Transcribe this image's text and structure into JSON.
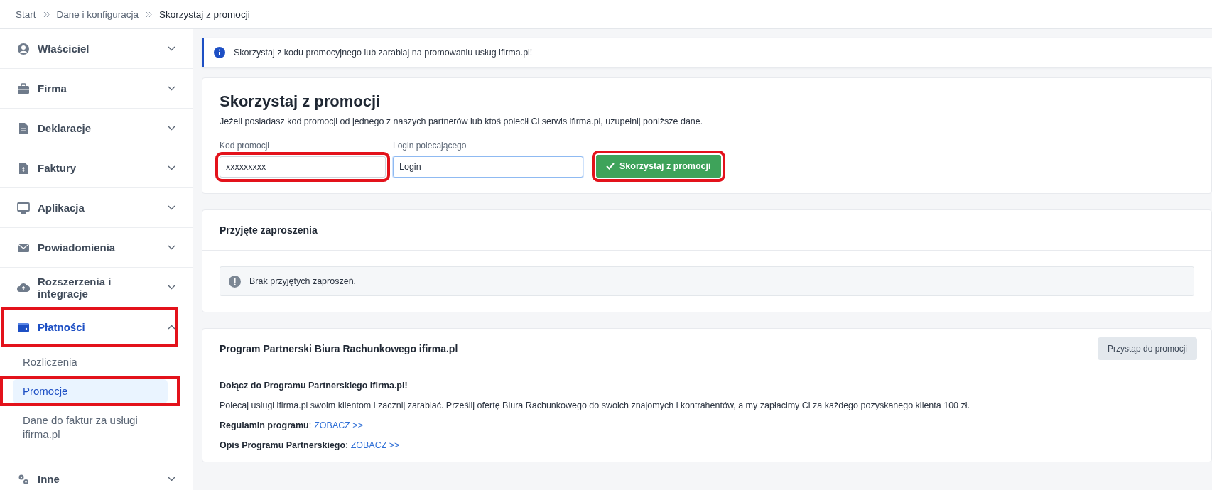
{
  "breadcrumb": [
    {
      "label": "Start",
      "current": false
    },
    {
      "label": "Dane i konfiguracja",
      "current": false
    },
    {
      "label": "Skorzystaj z promocji",
      "current": true
    }
  ],
  "sidebar": {
    "items": [
      {
        "label": "Właściciel",
        "expanded": false,
        "highlighted": false
      },
      {
        "label": "Firma",
        "expanded": false,
        "highlighted": false
      },
      {
        "label": "Deklaracje",
        "expanded": false,
        "highlighted": false
      },
      {
        "label": "Faktury",
        "expanded": false,
        "highlighted": false
      },
      {
        "label": "Aplikacja",
        "expanded": false,
        "highlighted": false
      },
      {
        "label": "Powiadomienia",
        "expanded": false,
        "highlighted": false
      },
      {
        "label": "Rozszerzenia i integracje",
        "expanded": false,
        "highlighted": false
      },
      {
        "label": "Płatności",
        "expanded": true,
        "highlighted": true,
        "children": [
          {
            "label": "Rozliczenia",
            "selected": false,
            "highlighted": false
          },
          {
            "label": "Promocje",
            "selected": true,
            "highlighted": true
          },
          {
            "label": "Dane do faktur za usługi ifirma.pl",
            "selected": false,
            "highlighted": false
          }
        ]
      },
      {
        "label": "Inne",
        "expanded": false,
        "highlighted": false
      }
    ]
  },
  "info_banner": "Skorzystaj z kodu promocyjnego lub zarabiaj na promowaniu usług ifirma.pl!",
  "promo_card": {
    "title": "Skorzystaj z promocji",
    "description": "Jeżeli posiadasz kod promocji od jednego z naszych partnerów lub ktoś polecił Ci serwis ifirma.pl, uzupełnij poniższe dane.",
    "fields": [
      {
        "label": "Kod promocji",
        "value": "xxxxxxxxx",
        "focused": false,
        "highlighted": true
      },
      {
        "label": "Login polecającego",
        "value": "Login",
        "focused": true,
        "highlighted": false
      }
    ],
    "submit": {
      "label": "Skorzystaj z promocji",
      "highlighted": true
    }
  },
  "invitations_card": {
    "title": "Przyjęte zaproszenia",
    "empty_message": "Brak przyjętych zaproszeń."
  },
  "partner_card": {
    "title": "Program Partnerski Biura Rachunkowego ifirma.pl",
    "button": "Przystąp do promocji",
    "heading": "Dołącz do Programu Partnerskiego ifirma.pl!",
    "paragraph": "Polecaj usługi ifirma.pl swoim klientom i zacznij zarabiać. Prześlij ofertę Biura Rachunkowego do swoich znajomych i kontrahentów, a my zapłacimy Ci za każdego pozyskanego klienta 100 zł.",
    "links": [
      {
        "label": "Regulamin programu",
        "separator": ":",
        "link": "ZOBACZ >>"
      },
      {
        "label": "Opis Programu Partnerskiego",
        "separator": ":",
        "link": "ZOBACZ >>"
      }
    ]
  }
}
